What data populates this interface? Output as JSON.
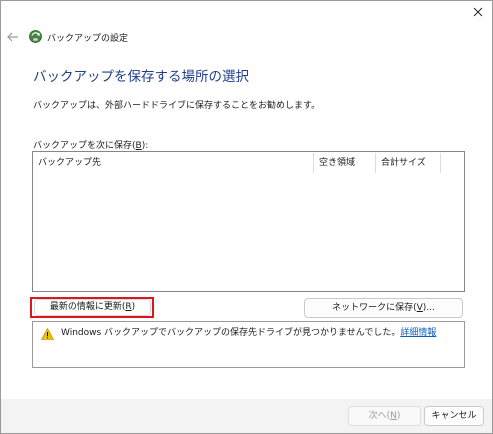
{
  "window": {
    "title": "バックアップの設定"
  },
  "main": {
    "heading": "バックアップを保存する場所の選択",
    "description": "バックアップは、外部ハードドライブに保存することをお勧めします。",
    "list_label": "バックアップを次に保存",
    "list_label_mnemonic": "B",
    "columns": [
      "バックアップ先",
      "空き領域",
      "合計サイズ"
    ]
  },
  "buttons": {
    "refresh_label": "最新の情報に更新",
    "refresh_mnemonic": "R",
    "network_label": "ネットワークに保存",
    "network_mnemonic": "V",
    "next_label": "次へ",
    "next_mnemonic": "N",
    "cancel_label": "キャンセル"
  },
  "warning": {
    "text": "Windows バックアップでバックアップの保存先ドライブが見つかりませんでした。",
    "link": "詳細情報"
  },
  "icons": {
    "close": "close-icon",
    "back": "back-arrow-icon",
    "app": "backup-app-icon",
    "warning": "warning-icon"
  },
  "colors": {
    "heading": "#1f3e8c",
    "link": "#0a5fc0",
    "highlight": "#e0141e",
    "warning": "#f2c200"
  }
}
